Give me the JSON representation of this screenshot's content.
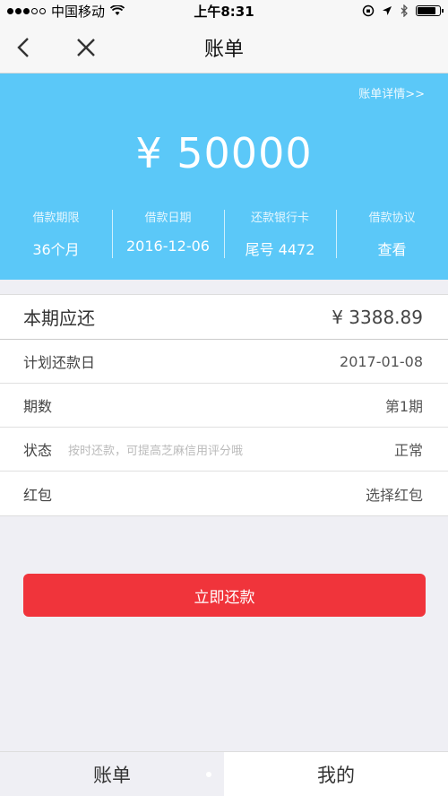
{
  "status": {
    "carrier": "中国移动",
    "time": "上午8:31",
    "battery_level": 0.85
  },
  "nav": {
    "title": "账单",
    "back_icon": "chevron-left-icon",
    "close_icon": "close-icon"
  },
  "hero": {
    "detail_link": "账单详情>>",
    "amount": "¥ 50000",
    "info": [
      {
        "label": "借款期限",
        "value": "36个月"
      },
      {
        "label": "借款日期",
        "value": "2016-12-06"
      },
      {
        "label": "还款银行卡",
        "value": "尾号 4472"
      },
      {
        "label": "借款协议",
        "value": "查看"
      }
    ],
    "background_color": "#5bc8f8"
  },
  "list": {
    "head": {
      "label": "本期应还",
      "value": "¥ 3388.89"
    },
    "rows": [
      {
        "label": "计划还款日",
        "hint": "",
        "value": "2017-01-08"
      },
      {
        "label": "期数",
        "hint": "",
        "value": "第1期"
      },
      {
        "label": "状态",
        "hint": "按时还款，可提高芝麻信用评分哦",
        "value": "正常"
      },
      {
        "label": "红包",
        "hint": "",
        "value": "选择红包"
      }
    ]
  },
  "pay_button": {
    "label": "立即还款",
    "color": "#f0343b"
  },
  "tabbar": {
    "tabs": [
      {
        "label": "账单"
      },
      {
        "label": "我的"
      }
    ]
  }
}
